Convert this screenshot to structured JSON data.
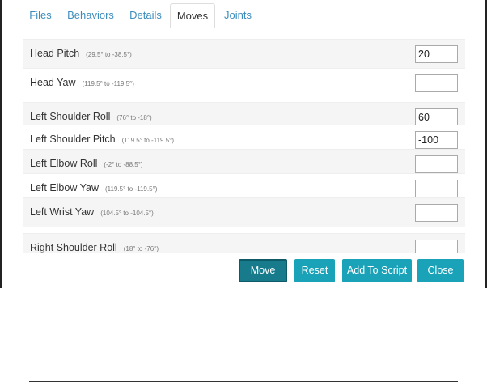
{
  "tabs": [
    {
      "label": "Files",
      "active": false
    },
    {
      "label": "Behaviors",
      "active": false
    },
    {
      "label": "Details",
      "active": false
    },
    {
      "label": "Moves",
      "active": true
    },
    {
      "label": "Joints",
      "active": false
    }
  ],
  "moves": [
    {
      "label": "Head Pitch",
      "range": "(29.5° to -38.5°)",
      "value": "20"
    },
    {
      "label": "Head Yaw",
      "range": "(119.5° to -119.5°)",
      "value": ""
    },
    {
      "label": "Left Shoulder Roll",
      "range": "(76° to -18°)",
      "value": "60"
    },
    {
      "label": "Left Shoulder Pitch",
      "range": "(119.5° to -119.5°)",
      "value": "-100"
    },
    {
      "label": "Left Elbow Roll",
      "range": "(-2° to -88.5°)",
      "value": ""
    },
    {
      "label": "Left Elbow Yaw",
      "range": "(119.5° to -119.5°)",
      "value": ""
    },
    {
      "label": "Left Wrist Yaw",
      "range": "(104.5° to -104.5°)",
      "value": ""
    },
    {
      "label": "Right Shoulder Roll",
      "range": "(18° to -76°)",
      "value": ""
    }
  ],
  "buttons": {
    "move": "Move",
    "reset": "Reset",
    "add_to_script": "Add To Script",
    "close": "Close"
  },
  "colors": {
    "tab_link": "#3c8dbc",
    "button": "#1aa3b8",
    "button_active": "#177b8c",
    "row_shade": "#f5f5f5"
  }
}
